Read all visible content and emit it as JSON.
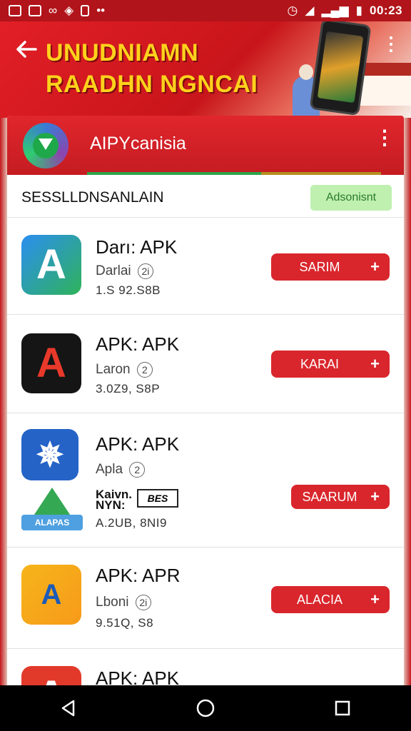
{
  "status_bar": {
    "time": "00:23"
  },
  "banner": {
    "title_line1": "UNUDNIAMN",
    "title_line2": "RAADHN NGNCAI"
  },
  "card": {
    "app_title": "AIPYcanisia",
    "section_label": "SESSLLDNSANLAIN",
    "section_button": "Adsonisnt"
  },
  "apps": [
    {
      "name": "Darı: APK",
      "publisher": "Darlai",
      "rating_badge": "2i",
      "size": "1.S 92.S8B",
      "action": "SARIM"
    },
    {
      "name": "APK: APK",
      "publisher": "Laron",
      "rating_badge": "2",
      "size": "3.0Z9, S8P",
      "action": "KARAI"
    },
    {
      "name": "APK: APK",
      "publisher": "Apla",
      "rating_badge": "2",
      "size": "A.2UB, 8NI9",
      "action": "SAARUM",
      "extra_line1": "Kaivn.",
      "extra_line2": "NYN:",
      "extra_badge": "BES",
      "extra_icon_label": "ALAPAS"
    },
    {
      "name": "APK: APR",
      "publisher": "Lboni",
      "rating_badge": "2i",
      "size": "9.51Q, S8",
      "action": "ALACIA"
    },
    {
      "name": "APK: APK"
    }
  ],
  "icons": {
    "back": "arrow-left-icon",
    "more": "more-vertical-icon",
    "plus": "+",
    "nav": [
      "back-triangle-icon",
      "home-circle-icon",
      "recents-square-icon"
    ]
  },
  "colors": {
    "primary_red": "#d9262c",
    "accent_green": "#2ca44a",
    "banner_yellow": "#ffd21c"
  }
}
